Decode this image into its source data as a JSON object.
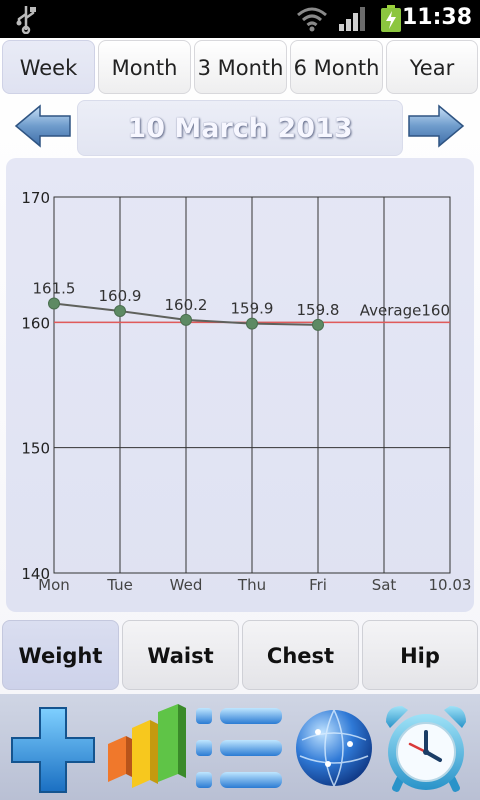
{
  "status_bar": {
    "time": "11:38"
  },
  "period_tabs": [
    "Week",
    "Month",
    "3 Month",
    "6 Month",
    "Year"
  ],
  "active_period": "Week",
  "date_label": "10 March 2013",
  "metric_tabs": [
    "Weight",
    "Waist",
    "Chest",
    "Hip"
  ],
  "active_metric": "Weight",
  "colors": {
    "line": "#5f615c",
    "point": "#5d8a63",
    "average_line": "#e15a5a",
    "grid": "#333333"
  },
  "bottom_icons": [
    "add-entry-icon",
    "chart-icon",
    "list-icon",
    "globe-icon",
    "alarm-clock-icon"
  ],
  "chart_data": {
    "type": "line",
    "categories": [
      "Mon",
      "Tue",
      "Wed",
      "Thu",
      "Fri",
      "Sat",
      "10.03"
    ],
    "series": [
      {
        "values": [
          161.5,
          160.9,
          160.2,
          159.9,
          159.8,
          null,
          null
        ]
      }
    ],
    "point_labels": [
      "161.5",
      "160.9",
      "160.2",
      "159.9",
      "159.8"
    ],
    "y_ticks": [
      "170",
      "160",
      "150",
      "140"
    ],
    "ylim": [
      140,
      170
    ],
    "grid": true,
    "average": {
      "value": 160,
      "label": "Average160"
    },
    "title": "",
    "xlabel": "",
    "ylabel": ""
  }
}
